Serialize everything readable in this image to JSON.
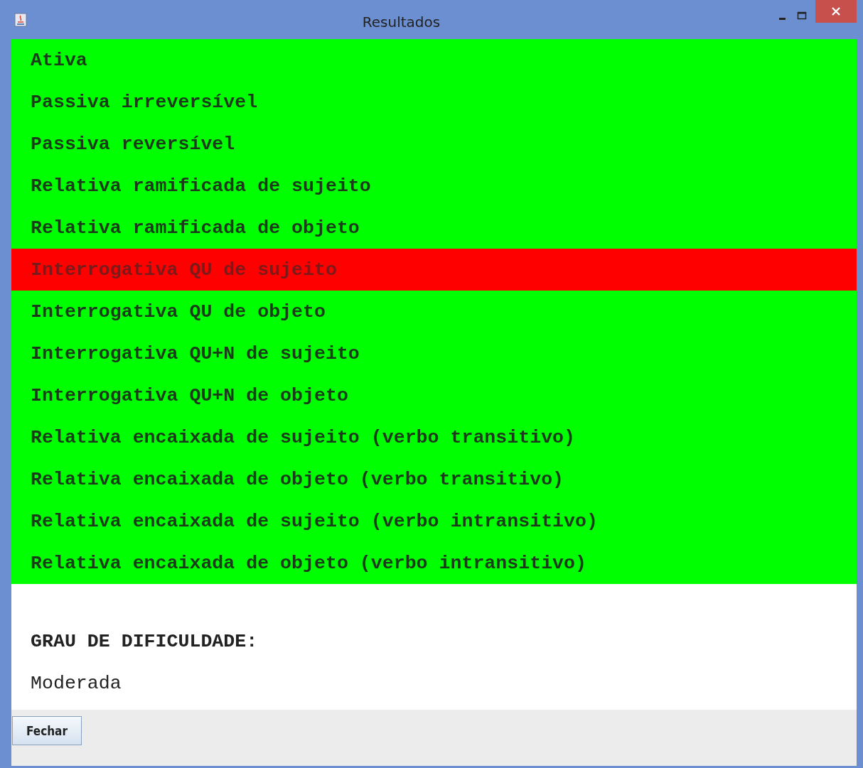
{
  "window": {
    "title": "Resultados"
  },
  "results": [
    {
      "label": "Ativa",
      "correct": true
    },
    {
      "label": "Passiva irreversível",
      "correct": true
    },
    {
      "label": "Passiva reversível",
      "correct": true
    },
    {
      "label": "Relativa ramificada de sujeito",
      "correct": true
    },
    {
      "label": "Relativa ramificada de objeto",
      "correct": true
    },
    {
      "label": "Interrogativa QU de sujeito",
      "correct": false
    },
    {
      "label": "Interrogativa QU de objeto",
      "correct": true
    },
    {
      "label": "Interrogativa QU+N de sujeito",
      "correct": true
    },
    {
      "label": "Interrogativa QU+N de objeto",
      "correct": true
    },
    {
      "label": "Relativa encaixada de sujeito (verbo transitivo)",
      "correct": true
    },
    {
      "label": "Relativa encaixada de objeto (verbo transitivo)",
      "correct": true
    },
    {
      "label": "Relativa encaixada de sujeito (verbo intransitivo)",
      "correct": true
    },
    {
      "label": "Relativa encaixada de objeto (verbo intransitivo)",
      "correct": true
    }
  ],
  "difficulty": {
    "heading": "GRAU DE DIFICULDADE:",
    "value": "Moderada"
  },
  "buttons": [
    "Fechar"
  ]
}
